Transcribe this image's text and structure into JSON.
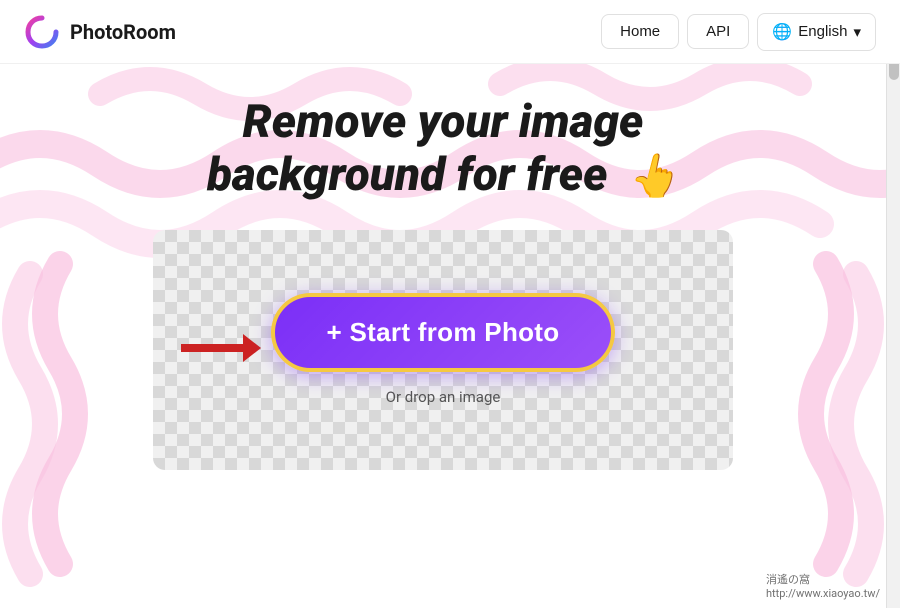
{
  "header": {
    "logo_text": "PhotoRoom",
    "nav": {
      "home_label": "Home",
      "api_label": "API",
      "lang_icon": "🌐",
      "lang_label": "English",
      "chevron": "▾"
    }
  },
  "main": {
    "title_line1": "Remove your image",
    "title_line2": "background for free",
    "hand_emoji": "👆",
    "upload_button": "+ Start from Photo",
    "drop_text": "Or drop an image"
  },
  "watermark": {
    "line1": "消遙の窩",
    "line2": "http://www.xiaoyao.tw/"
  },
  "colors": {
    "button_bg_start": "#7b2ff7",
    "button_bg_end": "#9b4ff9",
    "button_border": "#f5c842",
    "arrow_color": "#cc2222"
  }
}
